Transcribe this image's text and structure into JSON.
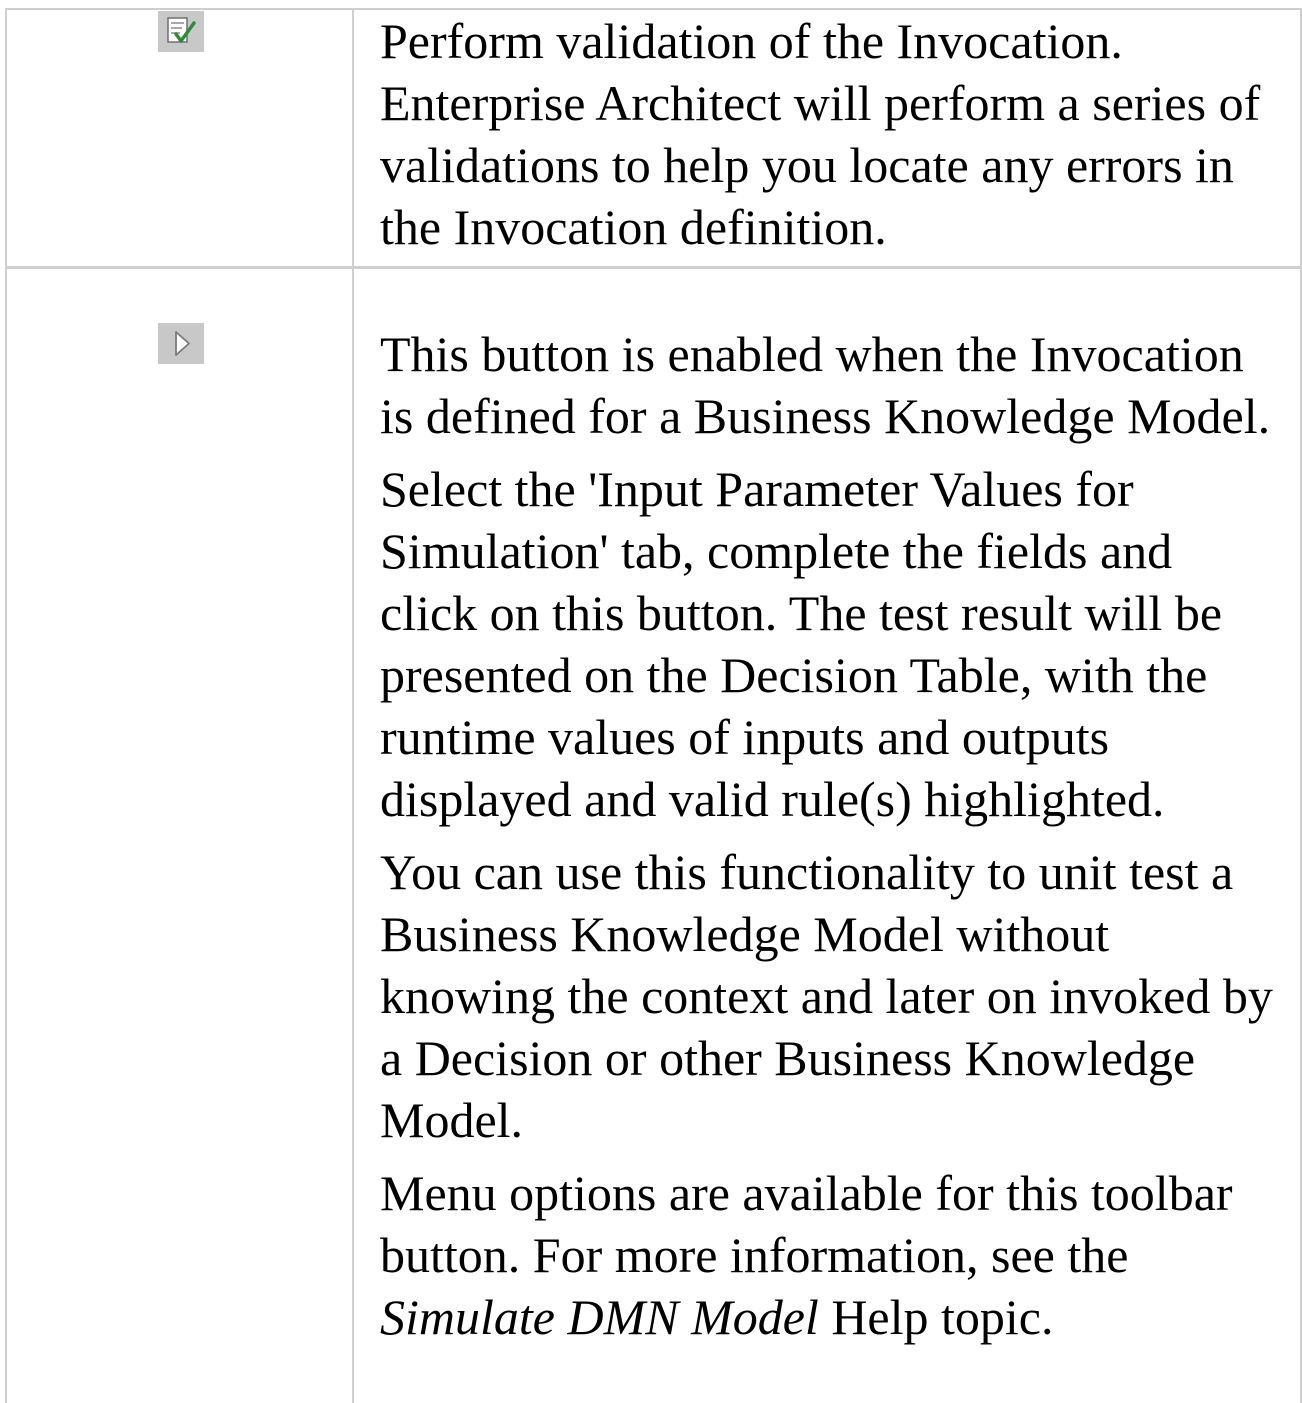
{
  "rows": [
    {
      "icon": "validate-icon",
      "paragraphs": [
        "Perform validation of the Invocation. Enterprise Architect will perform a series of validations to help you locate any errors in the Invocation definition."
      ]
    },
    {
      "icon": "run-simulation-icon",
      "paragraphs": [
        "This button is enabled when the Invocation is defined for a Business Knowledge Model.",
        "Select the 'Input Parameter Values for Simulation' tab, complete the fields and click on this button. The test result will be presented on the Decision Table, with the runtime values of inputs and outputs displayed and valid rule(s) highlighted.",
        "You can use this functionality to unit test a Business Knowledge Model without knowing the context and later on invoked by a Decision or other Business Knowledge Model."
      ],
      "last_paragraph": {
        "before": "Menu options are available for this toolbar button. For more information, see the ",
        "reference": "Simulate DMN Model",
        "after": " Help topic."
      }
    }
  ],
  "colors": {
    "border": "#cfcfcf",
    "icon_bg": "#c8c8c8",
    "icon_check": "#2e8b3a"
  }
}
